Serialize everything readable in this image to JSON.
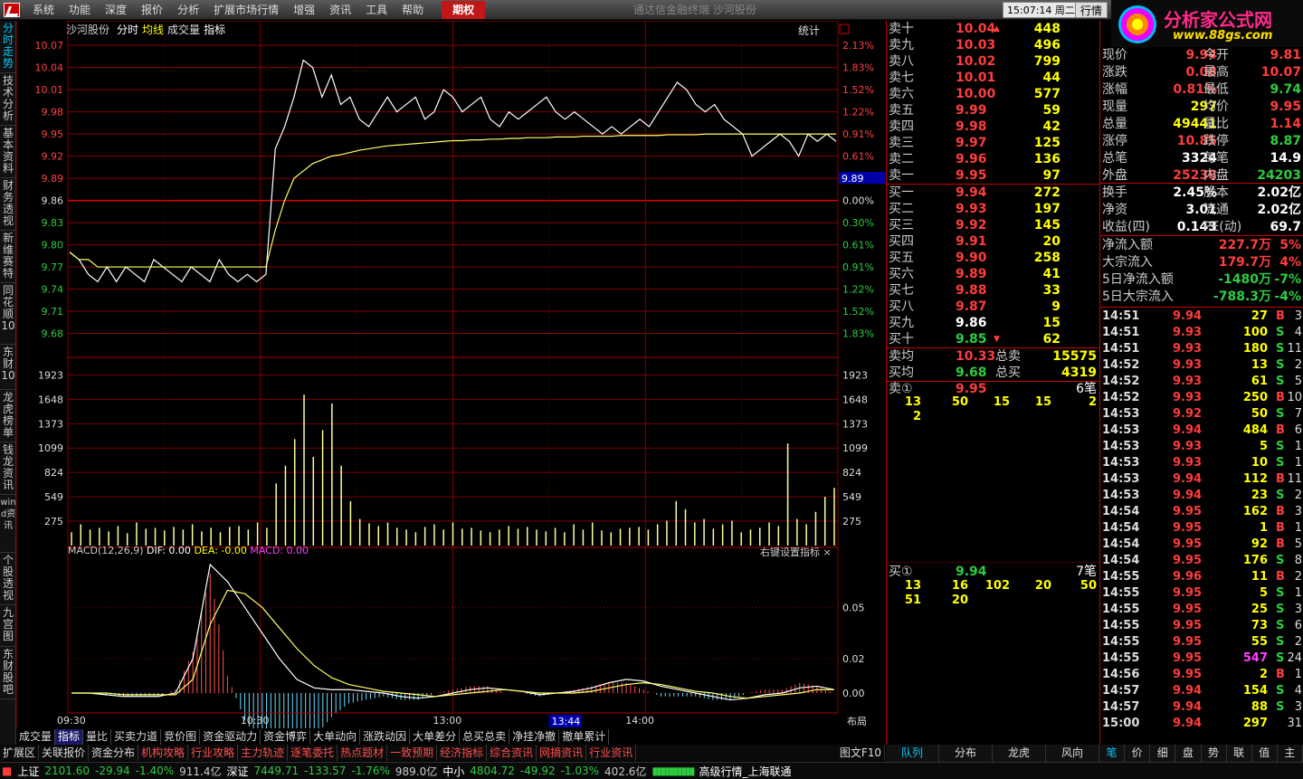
{
  "menubar": {
    "items": [
      "系统",
      "功能",
      "深度",
      "报价",
      "分析",
      "扩展市场行情",
      "增强",
      "资讯",
      "工具",
      "帮助"
    ],
    "highlight": "期权",
    "center_title": "通达信金融终端   沙河股份",
    "clock": "15:07:14",
    "weekday": "周二",
    "quote_button": "行情"
  },
  "brand": {
    "name": "分析家公式网",
    "url": "www.88gs.com"
  },
  "left_tabs": [
    "分时走势",
    "技术分析",
    "基本资料",
    "财务透视",
    "新维赛特",
    "同花顺10",
    "东财10",
    "龙虎榜单",
    "钱龙资讯",
    "wind资讯",
    "个股透视",
    "九宫图",
    "东财股吧"
  ],
  "chart": {
    "stock": "沙河股份",
    "mode": "分时",
    "avg_label": "均线",
    "vol_label": "成交量",
    "ind_label": "指标",
    "stat_label": "统计",
    "current_price_tag": "9.89",
    "time_tag": "13:44",
    "layout_label": "布局",
    "price_ticks": [
      "10.07",
      "10.04",
      "10.01",
      "9.98",
      "9.95",
      "9.92",
      "9.89",
      "9.86",
      "9.83",
      "9.80",
      "9.77",
      "9.74",
      "9.71",
      "9.68"
    ],
    "pct_ticks": [
      "2.13%",
      "1.83%",
      "1.52%",
      "1.22%",
      "0.91%",
      "0.61%",
      "0.30%",
      "0.00%",
      "0.30%",
      "0.61%",
      "0.91%",
      "1.22%",
      "1.52%",
      "1.83%"
    ],
    "vol_ticks": [
      "1923",
      "1648",
      "1373",
      "1099",
      "824",
      "549",
      "275"
    ],
    "macd_ticks": [
      "0.05",
      "0.02",
      "0.00"
    ],
    "time_ticks": [
      "09:30",
      "10:30",
      "13:00",
      "14:00"
    ],
    "macd_title": "MACD(12,26,9)",
    "macd_dif": "DIF: 0.00",
    "macd_dea": "DEA: -0.00",
    "macd_macd": "MACD: 0.00",
    "macd_right": "右键设置指标 ×"
  },
  "chart_data": {
    "type": "line",
    "x_label": "time",
    "prev_close": 9.86,
    "price": [
      9.79,
      9.78,
      9.76,
      9.75,
      9.77,
      9.75,
      9.77,
      9.76,
      9.75,
      9.78,
      9.77,
      9.76,
      9.75,
      9.77,
      9.76,
      9.75,
      9.78,
      9.76,
      9.75,
      9.76,
      9.75,
      9.76,
      9.93,
      9.96,
      10.0,
      10.05,
      10.04,
      10.0,
      10.03,
      9.99,
      10.0,
      9.97,
      9.96,
      9.98,
      10.0,
      9.98,
      9.99,
      10.0,
      9.97,
      9.98,
      10.01,
      10.0,
      9.98,
      9.99,
      10.0,
      9.97,
      9.96,
      9.98,
      9.97,
      9.98,
      9.99,
      10.0,
      9.98,
      9.97,
      9.98,
      9.97,
      9.96,
      9.95,
      9.96,
      9.95,
      9.96,
      9.97,
      9.96,
      9.98,
      10.0,
      10.02,
      10.01,
      9.99,
      9.98,
      9.99,
      9.97,
      9.96,
      9.95,
      9.92,
      9.93,
      9.94,
      9.95,
      9.94,
      9.92,
      9.95,
      9.94,
      9.95,
      9.94
    ],
    "avg": [
      9.79,
      9.78,
      9.78,
      9.77,
      9.77,
      9.77,
      9.77,
      9.77,
      9.77,
      9.77,
      9.77,
      9.77,
      9.77,
      9.77,
      9.77,
      9.77,
      9.77,
      9.77,
      9.77,
      9.77,
      9.77,
      9.77,
      9.82,
      9.86,
      9.89,
      9.9,
      9.91,
      9.915,
      9.92,
      9.922,
      9.925,
      9.928,
      9.93,
      9.932,
      9.934,
      9.935,
      9.936,
      9.937,
      9.938,
      9.939,
      9.94,
      9.941,
      9.941,
      9.942,
      9.942,
      9.943,
      9.943,
      9.944,
      9.944,
      9.945,
      9.945,
      9.945,
      9.946,
      9.946,
      9.946,
      9.947,
      9.947,
      9.947,
      9.947,
      9.948,
      9.948,
      9.948,
      9.948,
      9.948,
      9.949,
      9.949,
      9.949,
      9.949,
      9.95,
      9.95,
      9.95,
      9.95,
      9.95,
      9.95,
      9.95,
      9.95,
      9.95,
      9.95,
      9.95,
      9.95,
      9.95,
      9.95,
      9.95
    ],
    "volume": [
      150,
      240,
      180,
      200,
      160,
      220,
      140,
      260,
      190,
      200,
      170,
      210,
      180,
      240,
      160,
      200,
      150,
      210,
      220,
      180,
      260,
      200,
      700,
      900,
      1200,
      1700,
      1000,
      1300,
      1600,
      900,
      500,
      300,
      250,
      220,
      260,
      200,
      180,
      150,
      210,
      240,
      180,
      260,
      190,
      200,
      170,
      150,
      180,
      220,
      190,
      210,
      180,
      160,
      200,
      150,
      240,
      180,
      260,
      170,
      150,
      190,
      200,
      210,
      180,
      240,
      280,
      500,
      410,
      260,
      300,
      190,
      240,
      280,
      150,
      180,
      200,
      260,
      220,
      1150,
      300,
      240,
      380,
      550,
      650
    ],
    "macd_dif": [
      0,
      0,
      -0.001,
      -0.002,
      -0.002,
      -0.002,
      0,
      0.02,
      0.075,
      0.065,
      0.05,
      0.035,
      0.02,
      0.008,
      0.003,
      0.002,
      0.002,
      0.001,
      0.0,
      -0.002,
      -0.003,
      -0.002,
      0.0,
      0.002,
      0.003,
      0.002,
      0.001,
      -0.001,
      0.0,
      0.001,
      0.003,
      0.006,
      0.008,
      0.007,
      0.004,
      0.002,
      0.0,
      -0.002,
      -0.004,
      -0.003,
      -0.001,
      0.0,
      0.003,
      0.004,
      0.002
    ],
    "macd_dea": [
      0,
      0,
      0,
      -0.001,
      -0.001,
      -0.001,
      -0.001,
      0.008,
      0.04,
      0.06,
      0.058,
      0.05,
      0.038,
      0.026,
      0.016,
      0.009,
      0.005,
      0.003,
      0.001,
      0.0,
      -0.001,
      -0.002,
      -0.001,
      0.0,
      0.001,
      0.002,
      0.001,
      0.0,
      0.0,
      0.0,
      0.001,
      0.003,
      0.005,
      0.006,
      0.005,
      0.003,
      0.001,
      0.0,
      -0.002,
      -0.003,
      -0.002,
      -0.001,
      0.0,
      0.002,
      0.002
    ],
    "macd_hist": [
      0,
      0,
      -0.001,
      -0.002,
      -0.002,
      -0.002,
      0.002,
      0.024,
      0.07,
      0.01,
      -0.016,
      -0.03,
      -0.036,
      -0.036,
      -0.026,
      -0.014,
      -0.006,
      -0.004,
      -0.002,
      -0.004,
      -0.004,
      0.0,
      0.002,
      0.004,
      0.004,
      0.0,
      0.0,
      -0.002,
      0.0,
      0.002,
      0.004,
      0.006,
      0.006,
      0.002,
      -0.002,
      -0.002,
      -0.002,
      -0.004,
      -0.004,
      0.0,
      0.002,
      0.002,
      0.006,
      0.004,
      0.0
    ]
  },
  "orderbook": {
    "asks": [
      {
        "label": "卖十",
        "price": "10.04",
        "vol": "448",
        "arrow": "▲"
      },
      {
        "label": "卖九",
        "price": "10.03",
        "vol": "496"
      },
      {
        "label": "卖八",
        "price": "10.02",
        "vol": "799"
      },
      {
        "label": "卖七",
        "price": "10.01",
        "vol": "44"
      },
      {
        "label": "卖六",
        "price": "10.00",
        "vol": "577"
      },
      {
        "label": "卖五",
        "price": "9.99",
        "vol": "59"
      },
      {
        "label": "卖四",
        "price": "9.98",
        "vol": "42"
      },
      {
        "label": "卖三",
        "price": "9.97",
        "vol": "125"
      },
      {
        "label": "卖二",
        "price": "9.96",
        "vol": "136"
      },
      {
        "label": "卖一",
        "price": "9.95",
        "vol": "97"
      }
    ],
    "bids": [
      {
        "label": "买一",
        "price": "9.94",
        "vol": "272"
      },
      {
        "label": "买二",
        "price": "9.93",
        "vol": "197"
      },
      {
        "label": "买三",
        "price": "9.92",
        "vol": "145"
      },
      {
        "label": "买四",
        "price": "9.91",
        "vol": "20"
      },
      {
        "label": "买五",
        "price": "9.90",
        "vol": "258"
      },
      {
        "label": "买六",
        "price": "9.89",
        "vol": "41"
      },
      {
        "label": "买七",
        "price": "9.88",
        "vol": "33"
      },
      {
        "label": "买八",
        "price": "9.87",
        "vol": "9"
      },
      {
        "label": "买九",
        "price": "9.86",
        "vol": "15"
      },
      {
        "label": "买十",
        "price": "9.85",
        "vol": "62",
        "arrow": "▼"
      }
    ],
    "avg_ask_label": "卖均",
    "avg_ask": "10.33",
    "total_ask_label": "总卖",
    "total_ask": "15575",
    "avg_bid_label": "买均",
    "avg_bid": "9.68",
    "total_bid_label": "总买",
    "total_bid": "4319",
    "ask1_label": "卖①",
    "ask1_price": "9.95",
    "ask1_count": "6笔",
    "ask1_queue": [
      "13",
      "50",
      "15",
      "15",
      "2",
      "2"
    ],
    "bid1_label": "买①",
    "bid1_price": "9.94",
    "bid1_count": "7笔",
    "bid1_queue": [
      "13",
      "16",
      "102",
      "20",
      "50",
      "51",
      "20"
    ],
    "tabs": [
      "队列",
      "分布",
      "龙虎",
      "风向"
    ]
  },
  "stats": {
    "rows": [
      {
        "l1": "现价",
        "v1": "9.94",
        "l2": "今开",
        "v2": "9.81"
      },
      {
        "l1": "涨跌",
        "v1": "0.08",
        "l2": "最高",
        "v2": "10.07"
      },
      {
        "l1": "涨幅",
        "v1": "0.81%",
        "l2": "最低",
        "v2": "9.74"
      },
      {
        "l1": "现量",
        "v1": "297",
        "l2": "均价",
        "v2": "9.95"
      },
      {
        "l1": "总量",
        "v1": "49441",
        "l2": "量比",
        "v2": "1.14"
      },
      {
        "l1": "涨停",
        "v1": "10.85",
        "l2": "跌停",
        "v2": "8.87"
      },
      {
        "l1": "总笔",
        "v1": "3324",
        "l2": "每笔",
        "v2": "14.9"
      },
      {
        "l1": "外盘",
        "v1": "25238",
        "l2": "内盘",
        "v2": "24203"
      },
      {
        "l1": "换手",
        "v1": "2.45%",
        "l2": "股本",
        "v2": "2.02亿"
      },
      {
        "l1": "净资",
        "v1": "3.01",
        "l2": "流通",
        "v2": "2.02亿"
      },
      {
        "l1": "收益(四)",
        "v1": "0.143",
        "l2": "PE(动)",
        "v2": "69.7"
      }
    ],
    "flows": [
      {
        "label": "净流入额",
        "value": "227.7万",
        "pct": "5%"
      },
      {
        "label": "大宗流入",
        "value": "179.7万",
        "pct": "4%"
      },
      {
        "label": "5日净流入额",
        "value": "-1480万",
        "pct": "-7%"
      },
      {
        "label": "5日大宗流入",
        "value": "-788.3万",
        "pct": "-4%"
      }
    ],
    "ticks": [
      [
        "14:51",
        "9.94",
        "27",
        "B",
        "3"
      ],
      [
        "14:51",
        "9.93",
        "100",
        "S",
        "4"
      ],
      [
        "14:51",
        "9.93",
        "180",
        "S",
        "11"
      ],
      [
        "14:52",
        "9.93",
        "13",
        "S",
        "2"
      ],
      [
        "14:52",
        "9.93",
        "61",
        "S",
        "5"
      ],
      [
        "14:52",
        "9.93",
        "250",
        "B",
        "10"
      ],
      [
        "14:53",
        "9.92",
        "50",
        "S",
        "7"
      ],
      [
        "14:53",
        "9.94",
        "484",
        "B",
        "6"
      ],
      [
        "14:53",
        "9.93",
        "5",
        "S",
        "1"
      ],
      [
        "14:53",
        "9.93",
        "10",
        "S",
        "1"
      ],
      [
        "14:53",
        "9.94",
        "112",
        "B",
        "11"
      ],
      [
        "14:53",
        "9.94",
        "23",
        "S",
        "2"
      ],
      [
        "14:54",
        "9.95",
        "162",
        "B",
        "3"
      ],
      [
        "14:54",
        "9.95",
        "1",
        "B",
        "1"
      ],
      [
        "14:54",
        "9.95",
        "92",
        "B",
        "5"
      ],
      [
        "14:54",
        "9.95",
        "176",
        "S",
        "8"
      ],
      [
        "14:55",
        "9.96",
        "11",
        "B",
        "2"
      ],
      [
        "14:55",
        "9.95",
        "5",
        "S",
        "1"
      ],
      [
        "14:55",
        "9.95",
        "25",
        "S",
        "3"
      ],
      [
        "14:55",
        "9.95",
        "73",
        "S",
        "6"
      ],
      [
        "14:55",
        "9.95",
        "55",
        "S",
        "2"
      ],
      [
        "14:55",
        "9.95",
        "547",
        "S",
        "24"
      ],
      [
        "14:56",
        "9.95",
        "2",
        "B",
        "1"
      ],
      [
        "14:57",
        "9.94",
        "154",
        "S",
        "4"
      ],
      [
        "14:57",
        "9.94",
        "88",
        "S",
        "3"
      ],
      [
        "15:00",
        "9.94",
        "297",
        "",
        "31"
      ]
    ],
    "tabs": [
      "笔",
      "价",
      "细",
      "盘",
      "势",
      "联",
      "值",
      "主"
    ]
  },
  "bottom_tabs": [
    "成交量",
    "指标",
    "量比",
    "买卖力道",
    "竞价图",
    "资金驱动力",
    "资金博弈",
    "大单动向",
    "涨跌动因",
    "大单差分",
    "总买总卖",
    "净挂净撤",
    "撤单累计"
  ],
  "bottom_tabs2": [
    "扩展区",
    "关联报价",
    "资金分布",
    "机构攻略",
    "行业攻略",
    "主力轨迹",
    "逐笔委托",
    "热点题材",
    "一致预期",
    "经济指标",
    "综合资讯",
    "网摘资讯",
    "行业资讯"
  ],
  "bottom_right": "图文F10",
  "ticker": {
    "sh_label": "上证",
    "sh": "2101.60",
    "sh_chg": "-29.94",
    "sh_pct": "-1.40%",
    "sh_amt": "911.4亿",
    "sz_label": "深证",
    "sz": "7449.71",
    "sz_chg": "-133.57",
    "sz_pct": "-1.76%",
    "sz_amt": "989.0亿",
    "zx_label": "中小",
    "zx": "4804.72",
    "zx_chg": "-49.92",
    "zx_pct": "-1.03%",
    "zx_amt": "402.6亿",
    "status": "高级行情_上海联通"
  }
}
